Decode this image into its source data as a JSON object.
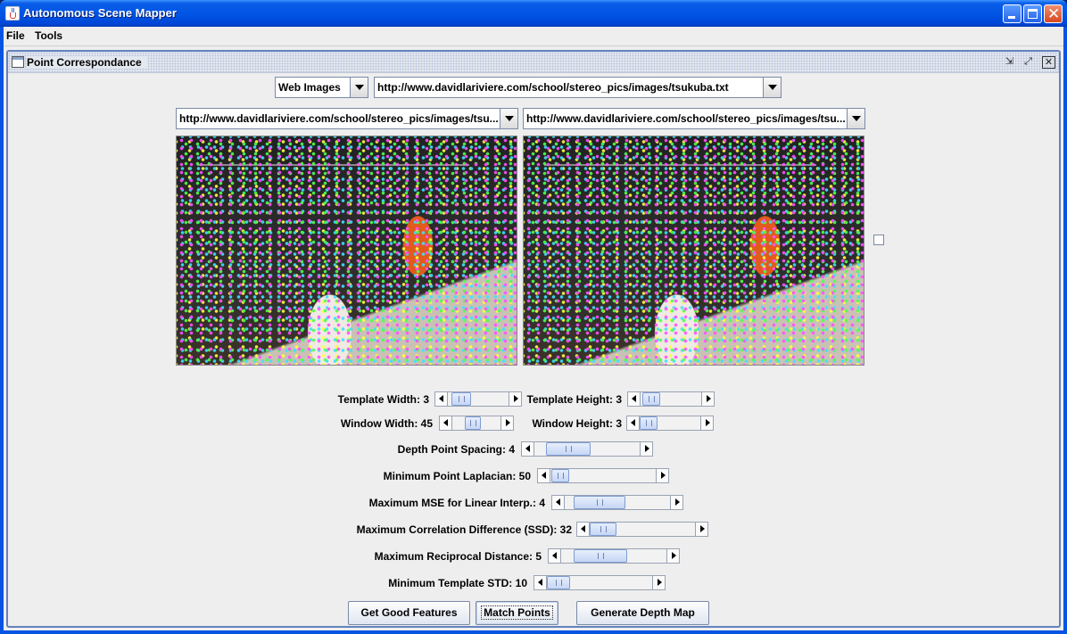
{
  "window": {
    "title": "Autonomous Scene Mapper"
  },
  "menubar": {
    "items": [
      "File",
      "Tools"
    ]
  },
  "internal_frame": {
    "title": "Point Correspondance"
  },
  "source": {
    "selected": "Web Images",
    "url": "http://www.davidlariviere.com/school/stereo_pics/images/tsukuba.txt"
  },
  "left_image": {
    "url": "http://www.davidlariviere.com/school/stereo_pics/images/tsu..."
  },
  "right_image": {
    "url": "http://www.davidlariviere.com/school/stereo_pics/images/tsu..."
  },
  "params": {
    "template_width": "Template Width: 3",
    "template_height": "Template Height: 3",
    "window_width": "Window Width: 45",
    "window_height": "Window Height: 3",
    "depth_point_spacing": "Depth Point Spacing: 4",
    "min_point_laplacian": "Minimum Point Laplacian: 50",
    "max_mse_linear": "Maximum MSE for Linear Interp.: 4",
    "max_corr_diff": "Maximum Correlation Difference (SSD): 32",
    "max_reciprocal": "Maximum Reciprocal Distance: 5",
    "min_template_std": "Minimum Template STD: 10"
  },
  "buttons": {
    "get_good_features": "Get Good Features",
    "match_points": "Match Points",
    "generate_depth_map": "Generate Depth Map"
  }
}
